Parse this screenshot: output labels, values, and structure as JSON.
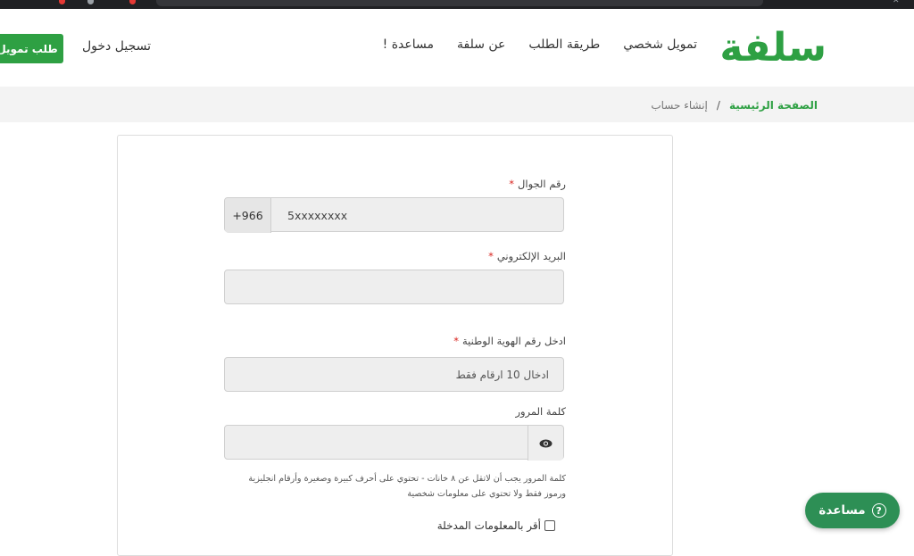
{
  "header": {
    "logo_text": "سلفة",
    "nav": [
      {
        "label": "تمويل شخصي"
      },
      {
        "label": "طريقة الطلب"
      },
      {
        "label": "عن سلفة"
      },
      {
        "label": "مساعدة !"
      }
    ],
    "login_label": "تسجيل دخول",
    "apply_label": "طلب تمويل"
  },
  "breadcrumb": {
    "home": "الصفحة الرئيسية",
    "separator": "/",
    "current": "إنشاء حساب"
  },
  "form": {
    "phone": {
      "label": "رقم الجوال",
      "required_mark": "*",
      "prefix": "+966",
      "value": "5xxxxxxxx"
    },
    "email": {
      "label": "البريد الإلكتروني",
      "required_mark": "*",
      "value": ""
    },
    "national_id": {
      "label": "ادخل رقم الهوية الوطنية",
      "required_mark": "*",
      "placeholder": "ادخال 10 ارقام فقط"
    },
    "password": {
      "label": "كلمة المرور",
      "value": ""
    },
    "password_hint": "كلمة المرور يجب أن لاتقل عن ٨ خانات - تحتوي على أحرف كبيرة وصغيرة وأرقام انجليزية ورموز فقط ولا تحتوي على معلومات شخصية",
    "agree_label": "أقر بالمعلومات المدخلة"
  },
  "help_button": {
    "label": "مساعدة",
    "icon": "question-circle-icon"
  },
  "colors": {
    "brand_green": "#2ea043",
    "help_green": "#2d8f55",
    "required_red": "#d9241f"
  }
}
